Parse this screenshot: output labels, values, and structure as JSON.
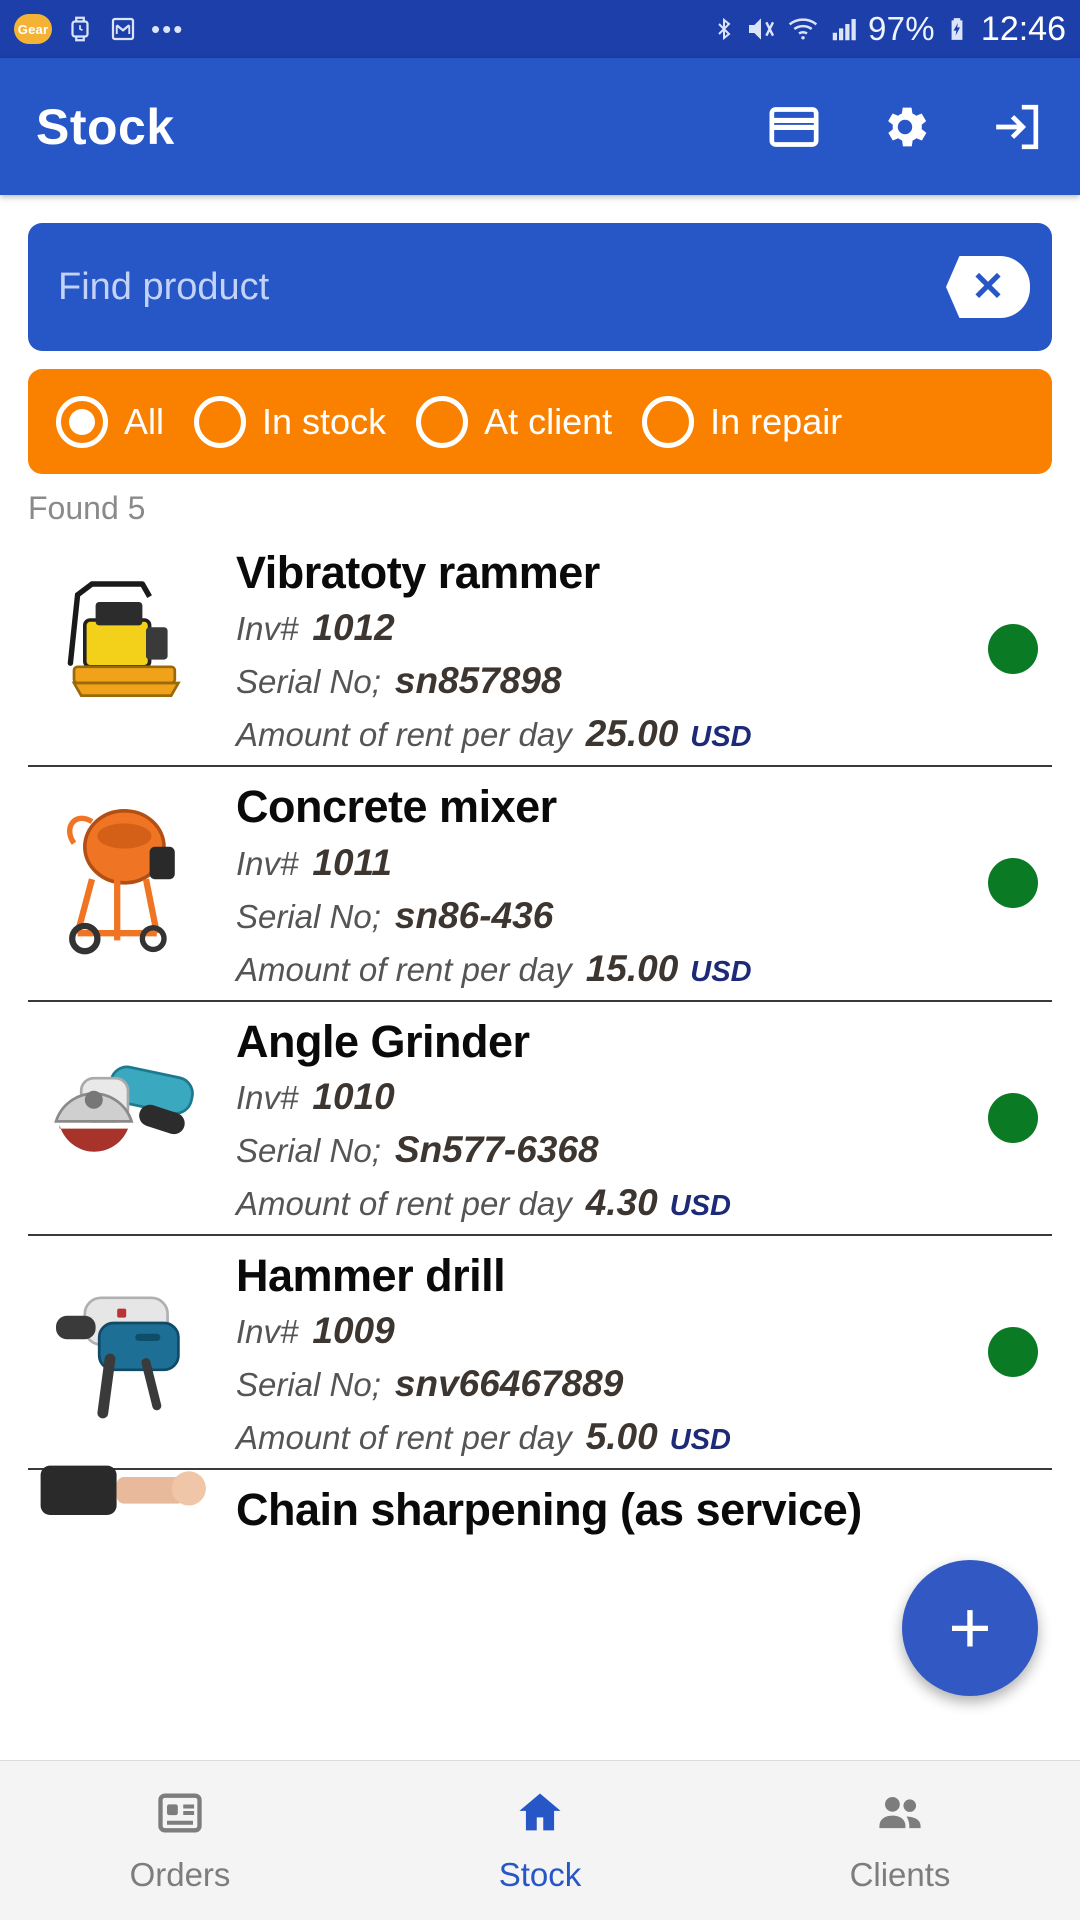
{
  "statusbar": {
    "gear_badge": "Gear",
    "icons": [
      "gear-badge-icon",
      "watch-icon",
      "gmail-icon",
      "more-dots-icon",
      "bluetooth-icon",
      "vibrate-mute-icon",
      "wifi-icon",
      "signal-icon",
      "battery-icon"
    ],
    "battery_text": "97%",
    "time": "12:46"
  },
  "appbar": {
    "title": "Stock",
    "actions": [
      {
        "name": "card-button",
        "icon": "card-icon"
      },
      {
        "name": "settings-button",
        "icon": "gear-icon"
      },
      {
        "name": "logout-button",
        "icon": "exit-icon"
      }
    ]
  },
  "search": {
    "value": "",
    "placeholder": "Find product",
    "clear_label": "✕"
  },
  "filters": {
    "selected": "All",
    "options": [
      {
        "label": "All",
        "checked": true
      },
      {
        "label": "In stock",
        "checked": false
      },
      {
        "label": "At client",
        "checked": false
      },
      {
        "label": "In repair",
        "checked": false
      }
    ]
  },
  "list": {
    "found_text": "Found 5",
    "labels": {
      "inv": "Inv#",
      "serial": "Serial No;",
      "rent": "Amount of rent per day"
    },
    "items": [
      {
        "name": "Vibratoty rammer",
        "inv": "1012",
        "serial": "sn857898",
        "rent": "25.00",
        "currency": "USD",
        "status_color": "#0a7a24",
        "thumb": "vibratory-rammer-image"
      },
      {
        "name": "Concrete mixer",
        "inv": "1011",
        "serial": "sn86-436",
        "rent": "15.00",
        "currency": "USD",
        "status_color": "#0a7a24",
        "thumb": "concrete-mixer-image"
      },
      {
        "name": "Angle Grinder",
        "inv": "1010",
        "serial": "Sn577-6368",
        "rent": "4.30",
        "currency": "USD",
        "status_color": "#0a7a24",
        "thumb": "angle-grinder-image"
      },
      {
        "name": "Hammer drill",
        "inv": "1009",
        "serial": "snv66467889",
        "rent": "5.00",
        "currency": "USD",
        "status_color": "#0a7a24",
        "thumb": "hammer-drill-image"
      },
      {
        "name": "Chain sharpening (as service)",
        "inv": "",
        "serial": "",
        "rent": "",
        "currency": "",
        "status_color": "#0a7a24",
        "thumb": "chain-sharpening-image"
      }
    ]
  },
  "fab": {
    "label": "+",
    "icon": "plus-icon"
  },
  "bottomnav": {
    "active": "Stock",
    "items": [
      {
        "label": "Orders",
        "icon": "orders-list-icon",
        "active": false
      },
      {
        "label": "Stock",
        "icon": "home-icon",
        "active": true
      },
      {
        "label": "Clients",
        "icon": "people-icon",
        "active": false
      }
    ]
  },
  "colors": {
    "primary": "#2756c6",
    "statusbar": "#1c3faa",
    "accent_orange": "#fa8100",
    "status_green": "#0a7a24",
    "currency_blue": "#1c2a78"
  }
}
